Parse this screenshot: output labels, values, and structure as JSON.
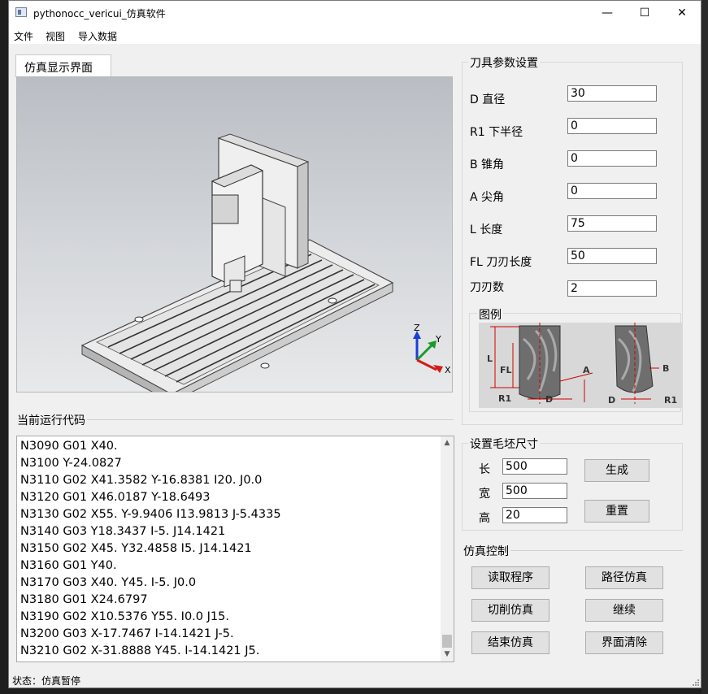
{
  "window": {
    "title": "pythonocc_vericui_仿真软件",
    "controls": {
      "minimize": "—",
      "maximize": "☐",
      "close": "✕"
    }
  },
  "menu": [
    "文件",
    "视图",
    "导入数据"
  ],
  "tab": {
    "label": "仿真显示界面"
  },
  "axes": {
    "z": "Z",
    "y": "Y",
    "x": "X"
  },
  "code_section": {
    "title": "当前运行代码",
    "lines": [
      "N3090 G01 X40.",
      "N3100 Y-24.0827",
      "N3110 G02 X41.3582 Y-16.8381 I20. J0.0",
      "N3120 G01 X46.0187 Y-18.6493",
      "N3130 G02 X55. Y-9.9406 I13.9813 J-5.4335",
      "N3140 G03 Y18.3437 I-5. J14.1421",
      "N3150 G02 X45. Y32.4858 I5. J14.1421",
      "N3160 G01 Y40.",
      "N3170 G03 X40. Y45. I-5. J0.0",
      "N3180 G01 X24.6797",
      "N3190 G02 X10.5376 Y55. I0.0 J15.",
      "N3200 G03 X-17.7467 I-14.1421 J-5.",
      "N3210 G02 X-31.8888 Y45. I-14.1421 J5."
    ]
  },
  "tool_params": {
    "title": "刀具参数设置",
    "fields": [
      {
        "label": "D 直径",
        "value": "30"
      },
      {
        "label": "R1 下半径",
        "value": "0"
      },
      {
        "label": "B 锥角",
        "value": "0"
      },
      {
        "label": "A 尖角",
        "value": "0"
      },
      {
        "label": "L 长度",
        "value": "75"
      },
      {
        "label": "FL 刀刃长度",
        "value": "50"
      },
      {
        "label": "刀刃数",
        "value": "2"
      }
    ],
    "legend_title": "图例",
    "diagram_labels": {
      "L": "L",
      "FL": "FL",
      "A": "A",
      "R1": "R1",
      "D": "D",
      "B": "B"
    }
  },
  "blank_size": {
    "title": "设置毛坯尺寸",
    "fields": [
      {
        "label": "长",
        "value": "500"
      },
      {
        "label": "宽",
        "value": "500"
      },
      {
        "label": "高",
        "value": "20"
      }
    ],
    "generate_button": "生成",
    "reset_button": "重置"
  },
  "sim_control": {
    "title": "仿真控制",
    "buttons": {
      "read_program": "读取程序",
      "path_sim": "路径仿真",
      "cut_sim": "切削仿真",
      "continue": "继续",
      "end_sim": "结束仿真",
      "clear": "界面清除"
    }
  },
  "status": {
    "text": "状态：仿真暂停"
  },
  "colors": {
    "accent_red": "#d00000",
    "axis_z": "#1a3fd6",
    "axis_y": "#1a9a2a",
    "axis_x": "#d41a1a"
  }
}
